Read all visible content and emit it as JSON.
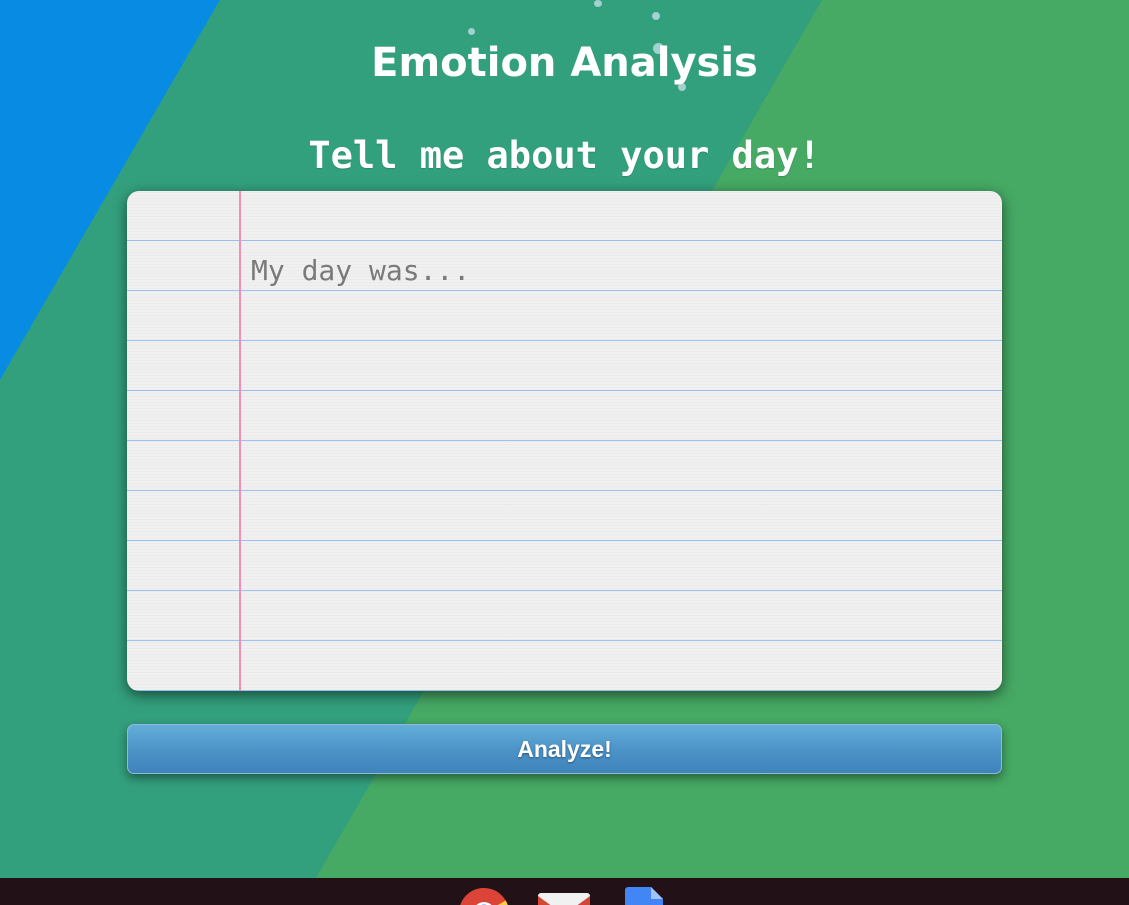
{
  "app": {
    "title": "Emotion Analysis",
    "prompt": "Tell me about your day!"
  },
  "journal": {
    "value": "",
    "placeholder": "My day was..."
  },
  "actions": {
    "analyze_label": "Analyze!"
  },
  "shelf": {
    "apps": [
      {
        "name": "chrome-icon"
      },
      {
        "name": "gmail-icon"
      },
      {
        "name": "docs-icon"
      }
    ]
  },
  "colors": {
    "wallpaper_blue": "#078be3",
    "wallpaper_teal": "#33a07d",
    "wallpaper_green": "#46a964",
    "ruled_line": "#9cc2f2",
    "margin_line": "#ef8fb4",
    "button": "#4b92c6",
    "shelf": "#221218"
  }
}
